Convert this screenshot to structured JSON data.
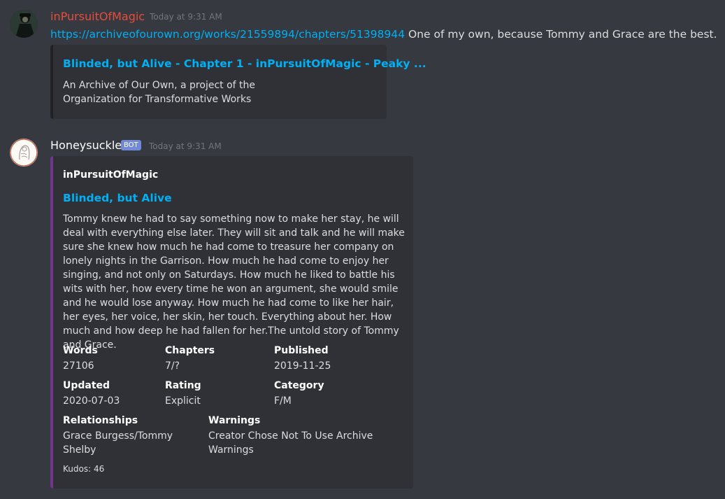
{
  "messages": [
    {
      "username": "inPursuitOfMagic",
      "username_color": "#e74c3c",
      "timestamp": "Today at 9:31 AM",
      "link": "https://archiveofourown.org/works/21559894/chapters/51398944",
      "text": " One of my own, because Tommy and Grace are the best.",
      "embed": {
        "title": "Blinded, but Alive - Chapter 1 - inPursuitOfMagic - Peaky ...",
        "description_line1": "An Archive of Our Own, a project of the",
        "description_line2": "Organization for Transformative Works"
      }
    },
    {
      "username": "Honeysuckle",
      "badge": "BOT",
      "timestamp": "Today at 9:31 AM",
      "embed": {
        "accent_color": "#71368a",
        "author": "inPursuitOfMagic",
        "title": "Blinded, but Alive",
        "description": "Tommy knew he had to say something now to make her stay, he will deal with everything else later. They will sit and talk and he will make sure she knew how much he had come to treasure her company on lonely nights in the Garrison. How much he had come to enjoy her singing, and not only on Saturdays. How much he liked to battle his wits with her, how every time he won an argument, she would smile and he would lose anyway. How much he had come to like her hair, her eyes, her voice, her skin, her touch. Everything about her. How much and how deep he had fallen for her.The untold story of Tommy and Grace.",
        "fields": {
          "words": {
            "name": "Words",
            "value": "27106"
          },
          "chapters": {
            "name": "Chapters",
            "value": "7/?"
          },
          "published": {
            "name": "Published",
            "value": "2019-11-25"
          },
          "updated": {
            "name": "Updated",
            "value": "2020-07-03"
          },
          "rating": {
            "name": "Rating",
            "value": "Explicit"
          },
          "category": {
            "name": "Category",
            "value": "F/M"
          },
          "relationships": {
            "name": "Relationships",
            "value": "Grace Burgess/Tommy Shelby"
          },
          "warnings": {
            "name": "Warnings",
            "value": "Creator Chose Not To Use Archive Warnings"
          }
        },
        "footer": "Kudos: 46"
      }
    }
  ]
}
